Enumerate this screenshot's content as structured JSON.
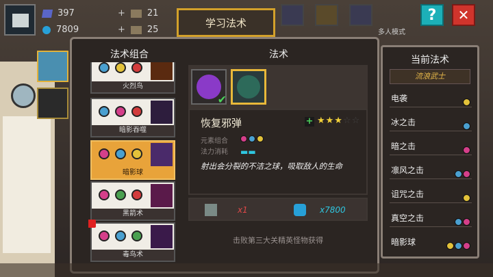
{
  "hud": {
    "gems": "397",
    "coins": "7809",
    "material1": "21",
    "material2": "25",
    "multiplayer_label": "多人模式"
  },
  "tab": {
    "label": "学习法术"
  },
  "buttons": {
    "help": "?",
    "close": "✕"
  },
  "panel": {
    "combos_title": "法术组合",
    "spells_title": "法术",
    "combos": [
      {
        "name": "火烈鸟",
        "elements": [
          "frost",
          "light",
          "fire"
        ]
      },
      {
        "name": "暗影吞噬",
        "elements": [
          "frost",
          "poison",
          "fire"
        ]
      },
      {
        "name": "暗影球",
        "elements": [
          "poison",
          "frost",
          "light"
        ],
        "selected": true
      },
      {
        "name": "黑箭术",
        "elements": [
          "poison",
          "green",
          "fire"
        ]
      },
      {
        "name": "毒鸟术",
        "elements": [
          "poison",
          "frost",
          "green"
        ],
        "new": true
      }
    ],
    "detail": {
      "name": "恢复邪弹",
      "plus": "+",
      "stars_filled": "★★★",
      "stars_empty": "☆☆",
      "rating": 3,
      "rating_max": 5,
      "element_label": "元素组合",
      "mana_label": "法力消耗",
      "mana_cost": "▬▬",
      "description": "射出会分裂的不洁之球，吸取敌人的生命",
      "cost_items": "x1",
      "cost_coins": "x7800",
      "unlock_text": "击败第三大关精英怪物获得"
    }
  },
  "current_spells": {
    "title": "当前法术",
    "class_name": "流浪武士",
    "items": [
      {
        "name": "电袭",
        "icons": [
          "light"
        ]
      },
      {
        "name": "冰之击",
        "icons": [
          "frost"
        ]
      },
      {
        "name": "暗之击",
        "icons": [
          "poison"
        ]
      },
      {
        "name": "凛风之击",
        "icons": [
          "frost",
          "poison"
        ]
      },
      {
        "name": "诅咒之击",
        "icons": [
          "light"
        ]
      },
      {
        "name": "真空之击",
        "icons": [
          "frost",
          "poison"
        ]
      },
      {
        "name": "暗影球",
        "icons": [
          "light",
          "frost",
          "poison"
        ]
      }
    ]
  },
  "colors": {
    "accent": "#d3a12a",
    "selected": "#e8a33a",
    "fire": "#d23c3c",
    "poison": "#d43f8a",
    "frost": "#4aa0d0",
    "light": "#e3c23a",
    "green": "#4aa050",
    "mana": "#2fc6e0"
  }
}
